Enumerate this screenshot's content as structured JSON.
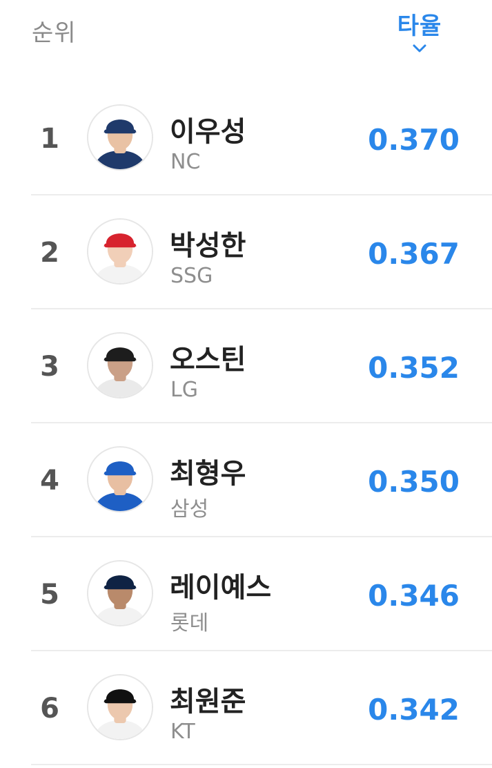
{
  "header": {
    "rank_label": "순위",
    "sort_label": "타율",
    "sort_icon": "chevron-down-icon",
    "accent_color": "#2a87ea"
  },
  "players": [
    {
      "rank": "1",
      "name": "이우성",
      "team": "NC",
      "avg": "0.370",
      "cap_color": "#1f3a6b",
      "jersey_color": "#1f3a6b",
      "skin_color": "#e9c2a4"
    },
    {
      "rank": "2",
      "name": "박성한",
      "team": "SSG",
      "avg": "0.367",
      "cap_color": "#d7232e",
      "jersey_color": "#f3f3f3",
      "skin_color": "#f1cfb8"
    },
    {
      "rank": "3",
      "name": "오스틴",
      "team": "LG",
      "avg": "0.352",
      "cap_color": "#1d1d1d",
      "jersey_color": "#eaeaea",
      "skin_color": "#caa087"
    },
    {
      "rank": "4",
      "name": "최형우",
      "team": "삼성",
      "avg": "0.350",
      "cap_color": "#1e5fc4",
      "jersey_color": "#1e5fc4",
      "skin_color": "#e8bfa2"
    },
    {
      "rank": "5",
      "name": "레이예스",
      "team": "롯데",
      "avg": "0.346",
      "cap_color": "#0f2344",
      "jersey_color": "#f2f2f2",
      "skin_color": "#b98a6b"
    },
    {
      "rank": "6",
      "name": "최원준",
      "team": "KT",
      "avg": "0.342",
      "cap_color": "#111111",
      "jersey_color": "#f2f2f2",
      "skin_color": "#ecc8ae"
    }
  ]
}
